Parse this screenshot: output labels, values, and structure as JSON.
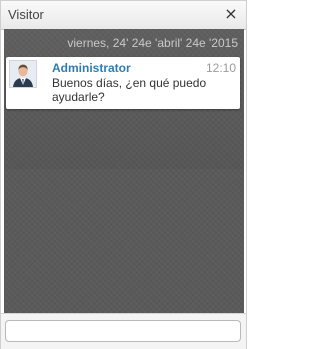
{
  "window": {
    "title": "Visitor",
    "close_glyph": "×",
    "close_icon": "close-icon"
  },
  "chat": {
    "date_label": "viernes, 24' 24e 'abril' 24e '2015",
    "messages": [
      {
        "author": "Administrator",
        "time": "12:10",
        "text": "Buenos días, ¿en qué puedo ayudarle?",
        "avatar_icon": "user-avatar-icon"
      }
    ]
  },
  "input": {
    "value": "",
    "placeholder": ""
  },
  "colors": {
    "chat_background": "#5a5a5a",
    "author_name": "#2f7db0",
    "bubble": "#ffffff"
  }
}
